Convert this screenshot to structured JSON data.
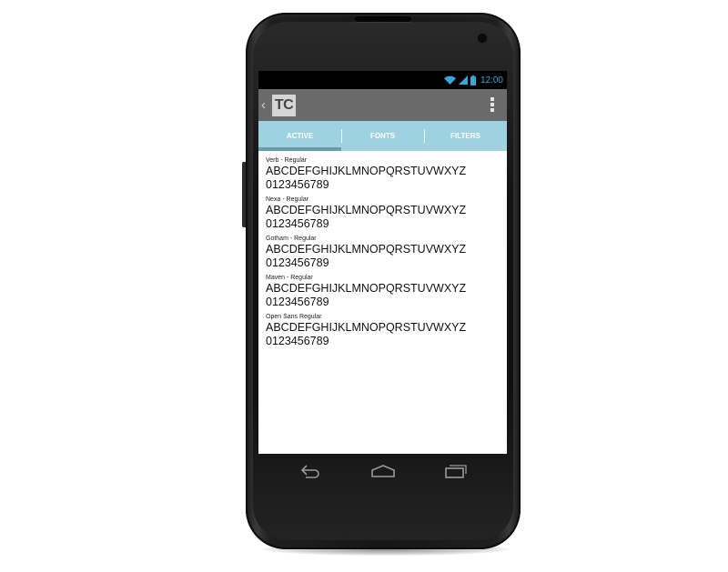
{
  "status_bar": {
    "time": "12:00",
    "icons": [
      "wifi-icon",
      "signal-icon",
      "battery-icon"
    ],
    "accent_color": "#3ba6d6"
  },
  "action_bar": {
    "logo_text": "TC",
    "up_icon": "chevron-left-icon",
    "overflow_icon": "overflow-menu-icon",
    "background_color": "#6a6a6a"
  },
  "tabs": [
    {
      "label": "ACTIVE",
      "active": true
    },
    {
      "label": "FONTS",
      "active": false
    },
    {
      "label": "FILTERS",
      "active": false
    }
  ],
  "tab_color": "#9fd2e0",
  "fonts": [
    {
      "name": "Verb - Regular",
      "letters": "ABCDEFGHIJKLMNOPQRSTUVWXYZ",
      "digits": "0123456789"
    },
    {
      "name": "Nexa - Regular",
      "letters": "ABCDEFGHIJKLMNOPQRSTUVWXYZ",
      "digits": "0123456789"
    },
    {
      "name": "Gotham - Regular",
      "letters": "ABCDEFGHIJKLMNOPQRSTUVWXYZ",
      "digits": "0123456789"
    },
    {
      "name": "Maven - Regular",
      "letters": "ABCDEFGHIJKLMNOPQRSTUVWXYZ",
      "digits": "0123456789"
    },
    {
      "name": "Open Sans Regular",
      "letters": "ABCDEFGHIJKLMNOPQRSTUVWXYZ",
      "digits": "0123456789"
    }
  ],
  "nav_bar": {
    "icons": [
      "back-icon",
      "home-icon",
      "recent-apps-icon"
    ]
  }
}
